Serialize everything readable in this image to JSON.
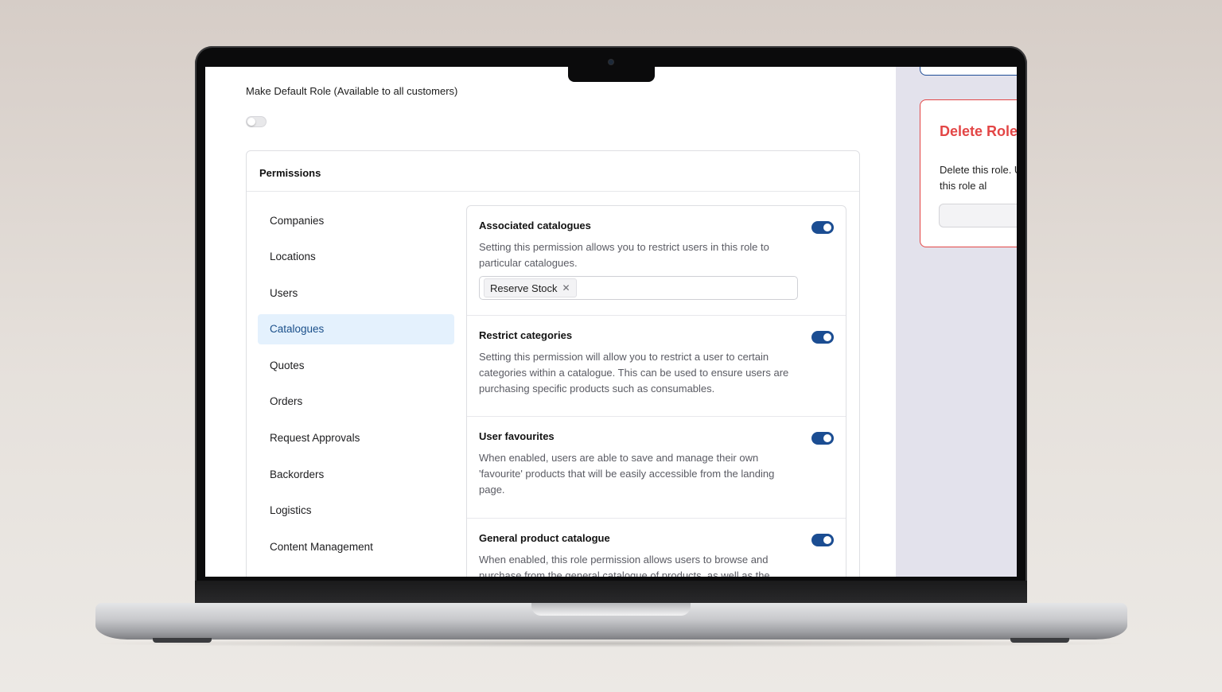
{
  "default_role": {
    "label": "Make Default Role (Available to all customers)",
    "enabled": false
  },
  "permissions": {
    "title": "Permissions",
    "nav": [
      {
        "label": "Companies",
        "active": false
      },
      {
        "label": "Locations",
        "active": false
      },
      {
        "label": "Users",
        "active": false
      },
      {
        "label": "Catalogues",
        "active": true
      },
      {
        "label": "Quotes",
        "active": false
      },
      {
        "label": "Orders",
        "active": false
      },
      {
        "label": "Request Approvals",
        "active": false
      },
      {
        "label": "Backorders",
        "active": false
      },
      {
        "label": "Logistics",
        "active": false
      },
      {
        "label": "Content Management",
        "active": false
      }
    ],
    "settings": [
      {
        "title": "Associated catalogues",
        "description": "Setting this permission allows you to restrict users in this role to particular catalogues.",
        "enabled": true,
        "tags": [
          "Reserve Stock"
        ]
      },
      {
        "title": "Restrict categories",
        "description": "Setting this permission will allow you to restrict a user to certain categories within a catalogue. This can be used to ensure users are purchasing specific products such as consumables.",
        "enabled": true
      },
      {
        "title": "User favourites",
        "description": "When enabled, users are able to save and manage their own 'favourite' products that will be easily accessible from the landing page.",
        "enabled": true
      },
      {
        "title": "General product catalogue",
        "description": "When enabled, this role permission allows users to browse and purchase from the general catalogue of products, as well as the",
        "enabled": true
      }
    ]
  },
  "delete_role": {
    "title": "Delete Role",
    "description": "Delete this role. Users that have this role al"
  },
  "colors": {
    "accent": "#1b4d92",
    "active_nav_bg": "#e4f1fd",
    "danger": "#e34646",
    "side_panel_bg": "#e3e2ec"
  }
}
